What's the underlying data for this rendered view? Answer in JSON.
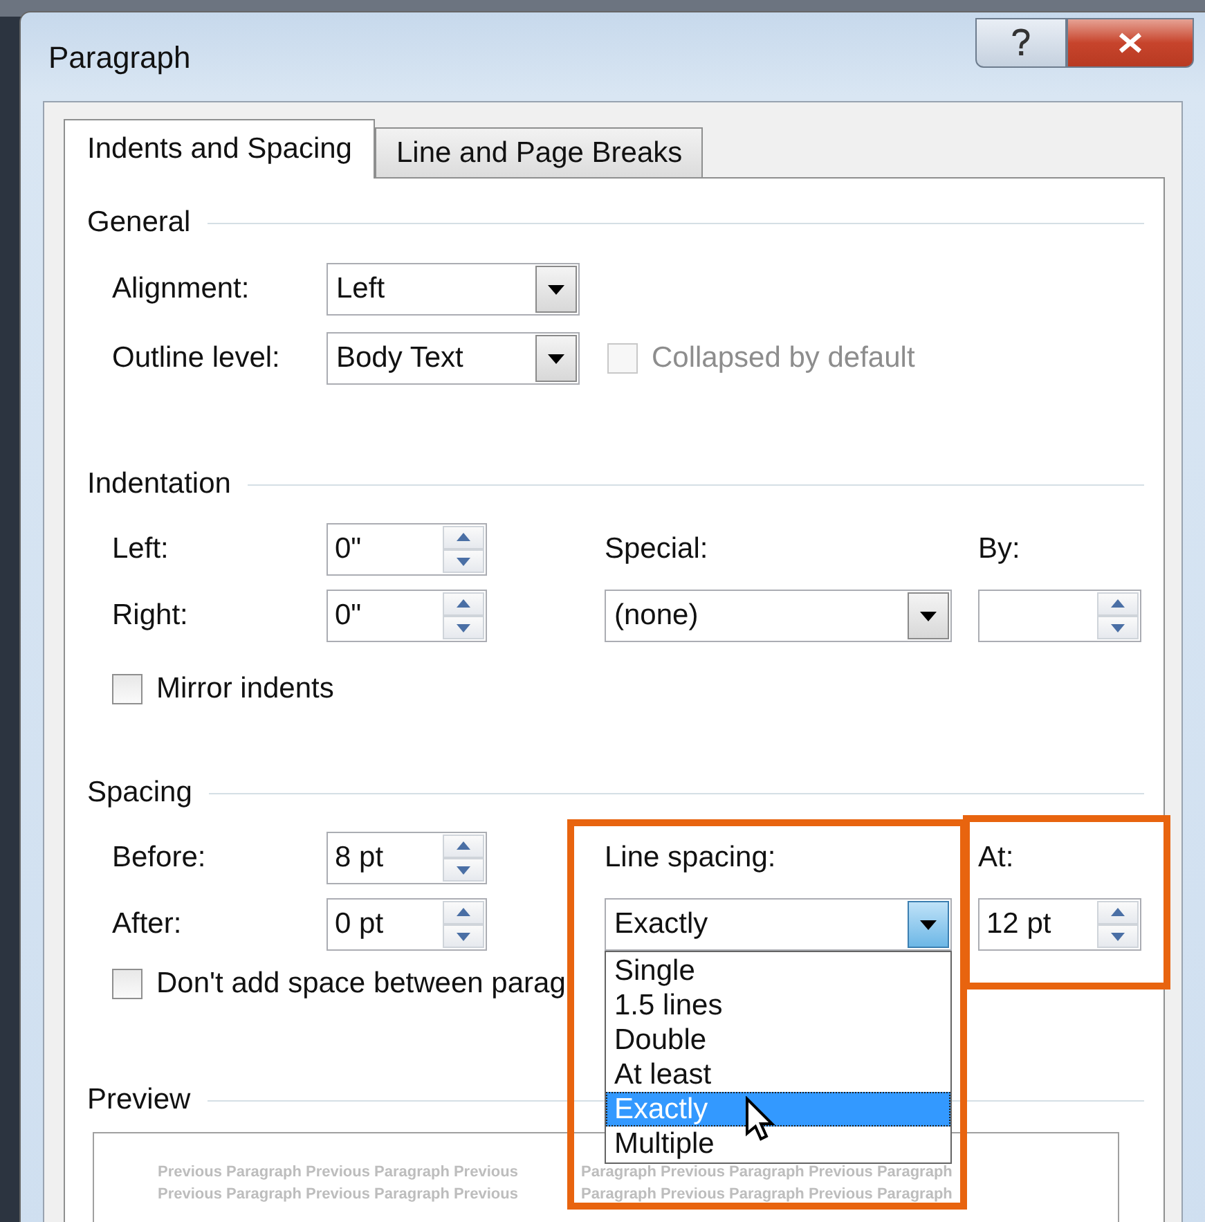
{
  "window": {
    "title": "Paragraph"
  },
  "tabs": [
    {
      "label": "Indents and Spacing",
      "selected": true
    },
    {
      "label": "Line and Page Breaks",
      "selected": false
    }
  ],
  "general": {
    "heading": "General",
    "alignment": {
      "label": "Alignment:",
      "value": "Left"
    },
    "outline_level": {
      "label": "Outline level:",
      "value": "Body Text"
    },
    "collapsed": {
      "label": "Collapsed by default",
      "checked": false,
      "disabled": true
    }
  },
  "indentation": {
    "heading": "Indentation",
    "left": {
      "label": "Left:",
      "value": "0\""
    },
    "right": {
      "label": "Right:",
      "value": "0\""
    },
    "special": {
      "label": "Special:",
      "value": "(none)"
    },
    "by": {
      "label": "By:"
    },
    "mirror": {
      "label": "Mirror indents",
      "checked": false,
      "disabled": false
    }
  },
  "spacing": {
    "heading": "Spacing",
    "before": {
      "label": "Before:",
      "value": "8 pt"
    },
    "after": {
      "label": "After:",
      "value": "0 pt"
    },
    "line_spacing": {
      "label": "Line spacing:",
      "value": "Exactly",
      "expanded": true,
      "options": [
        {
          "label": "Single",
          "selected": false
        },
        {
          "label": "1.5 lines",
          "selected": false
        },
        {
          "label": "Double",
          "selected": false
        },
        {
          "label": "At least",
          "selected": false
        },
        {
          "label": "Exactly",
          "selected": true
        },
        {
          "label": "Multiple",
          "selected": false
        }
      ]
    },
    "at": {
      "label": "At:",
      "value": "12 pt"
    },
    "dont_add": {
      "label": "Don't add space between parag",
      "checked": false,
      "disabled": false
    }
  },
  "preview": {
    "heading": "Preview",
    "lines": [
      {
        "left": "Previous Paragraph Previous Paragraph Previous",
        "middle": "Paragraph Previous Paragraph Previous Paragraph"
      },
      {
        "left": "Previous Paragraph Previous Paragraph Previous",
        "middle": "Paragraph Previous Paragraph Previous Paragraph"
      }
    ]
  }
}
